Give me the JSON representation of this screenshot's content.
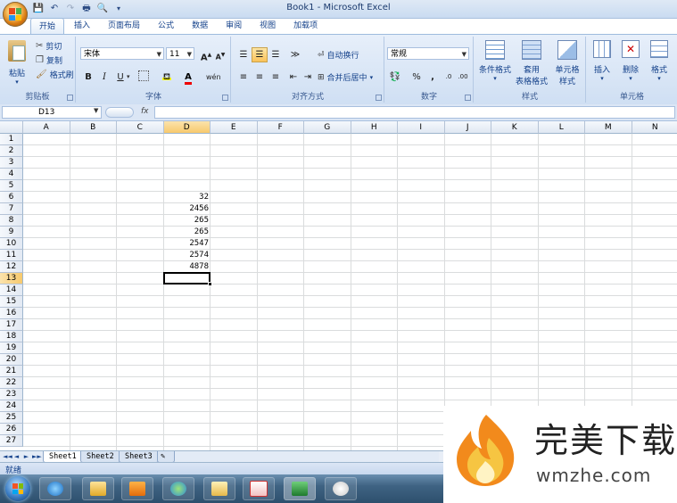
{
  "window": {
    "title": "Book1 - Microsoft Excel"
  },
  "ribbon": {
    "tabs": [
      "开始",
      "插入",
      "页面布局",
      "公式",
      "数据",
      "审阅",
      "视图",
      "加载项"
    ],
    "clipboard": {
      "title": "剪贴板",
      "paste": "粘贴",
      "cut": "剪切",
      "copy": "复制",
      "format_painter": "格式刷"
    },
    "font": {
      "title": "字体",
      "name": "宋体",
      "size": "11",
      "bold": "B",
      "italic": "I",
      "underline": "U",
      "grow": "A",
      "shrink": "A",
      "font_color_letter": "A",
      "phonetic": "wén"
    },
    "alignment": {
      "title": "对齐方式",
      "wrap_text": "自动换行",
      "merge_center": "合并后居中"
    },
    "number": {
      "title": "数字",
      "format": "常规",
      "percent": "%",
      "comma": ","
    },
    "styles": {
      "title": "样式",
      "conditional": "条件格式",
      "format_table_1": "套用",
      "format_table_2": "表格格式",
      "cell_styles_1": "单元格",
      "cell_styles_2": "样式"
    },
    "cells": {
      "title": "单元格",
      "insert": "插入",
      "delete": "删除",
      "format": "格式"
    }
  },
  "formula_bar": {
    "name_box": "D13",
    "fx": "fx",
    "formula": ""
  },
  "grid": {
    "columns": [
      "A",
      "B",
      "C",
      "D",
      "E",
      "F",
      "G",
      "H",
      "I",
      "J",
      "K",
      "L",
      "M",
      "N"
    ],
    "selected_column": "D",
    "rows": [
      "1",
      "2",
      "3",
      "4",
      "5",
      "6",
      "7",
      "8",
      "9",
      "10",
      "11",
      "12",
      "13",
      "14",
      "15",
      "16",
      "17",
      "18",
      "19",
      "20",
      "21",
      "22",
      "23",
      "24",
      "25",
      "26",
      "27"
    ],
    "selected_row": "13",
    "cells": [
      {
        "ref": "D6",
        "value": "32"
      },
      {
        "ref": "D7",
        "value": "2456"
      },
      {
        "ref": "D8",
        "value": "265"
      },
      {
        "ref": "D9",
        "value": "265"
      },
      {
        "ref": "D10",
        "value": "2547"
      },
      {
        "ref": "D11",
        "value": "2574"
      },
      {
        "ref": "D12",
        "value": "4878"
      }
    ],
    "active_cell": "D13"
  },
  "sheets": {
    "tabs": [
      "Sheet1",
      "Sheet2",
      "Sheet3"
    ],
    "active": "Sheet1",
    "nav": [
      "◄◄",
      "◄",
      "►",
      "►►"
    ]
  },
  "status": {
    "text": "就绪"
  },
  "taskbar": {
    "items": [
      "ie",
      "explorer",
      "media-player",
      "messenger",
      "outlook",
      "acrobat",
      "excel",
      "paint"
    ]
  },
  "watermark": {
    "title": "完美下载",
    "url": "wmzhe.com"
  },
  "colors": {
    "accent": "#15428b",
    "selected_header": "#f7c96d",
    "flame": "#f28a1c"
  }
}
